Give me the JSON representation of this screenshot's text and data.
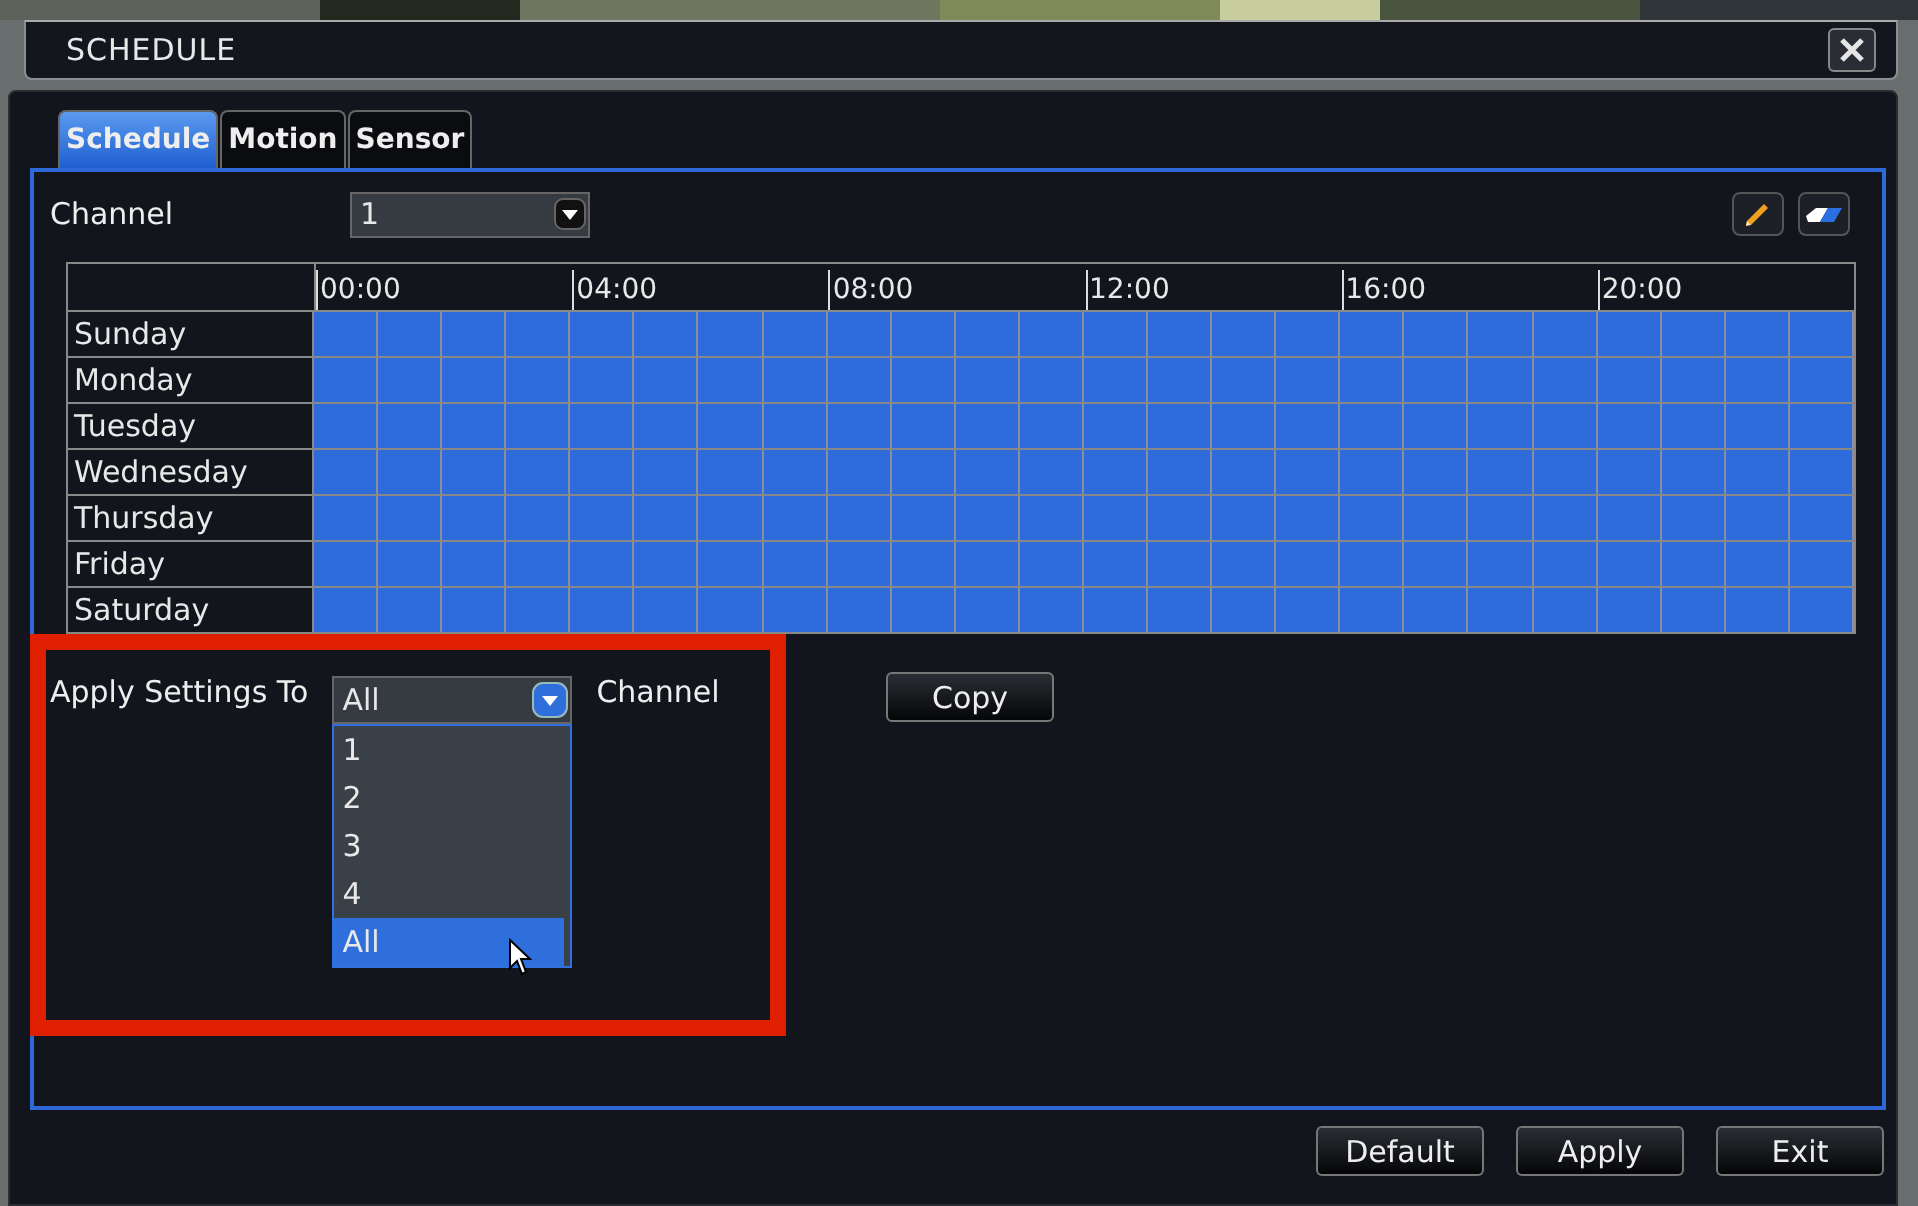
{
  "window": {
    "title": "SCHEDULE"
  },
  "tabs": [
    {
      "label": "Schedule",
      "selected": true
    },
    {
      "label": "Motion",
      "selected": false
    },
    {
      "label": "Sensor",
      "selected": false
    }
  ],
  "channel": {
    "label": "Channel",
    "value": "1"
  },
  "schedule": {
    "hour_labels": [
      "00:00",
      "04:00",
      "08:00",
      "12:00",
      "16:00",
      "20:00"
    ],
    "rows": [
      {
        "day": "Sunday",
        "hours": [
          true,
          true,
          true,
          true,
          true,
          true,
          true,
          true,
          true,
          true,
          true,
          true,
          true,
          true,
          true,
          true,
          true,
          true,
          true,
          true,
          true,
          true,
          true,
          true
        ]
      },
      {
        "day": "Monday",
        "hours": [
          true,
          true,
          true,
          true,
          true,
          true,
          true,
          true,
          true,
          true,
          true,
          true,
          true,
          true,
          true,
          true,
          true,
          true,
          true,
          true,
          true,
          true,
          true,
          true
        ]
      },
      {
        "day": "Tuesday",
        "hours": [
          true,
          true,
          true,
          true,
          true,
          true,
          true,
          true,
          true,
          true,
          true,
          true,
          true,
          true,
          true,
          true,
          true,
          true,
          true,
          true,
          true,
          true,
          true,
          true
        ]
      },
      {
        "day": "Wednesday",
        "hours": [
          true,
          true,
          true,
          true,
          true,
          true,
          true,
          true,
          true,
          true,
          true,
          true,
          true,
          true,
          true,
          true,
          true,
          true,
          true,
          true,
          true,
          true,
          true,
          true
        ]
      },
      {
        "day": "Thursday",
        "hours": [
          true,
          true,
          true,
          true,
          true,
          true,
          true,
          true,
          true,
          true,
          true,
          true,
          true,
          true,
          true,
          true,
          true,
          true,
          true,
          true,
          true,
          true,
          true,
          true
        ]
      },
      {
        "day": "Friday",
        "hours": [
          true,
          true,
          true,
          true,
          true,
          true,
          true,
          true,
          true,
          true,
          true,
          true,
          true,
          true,
          true,
          true,
          true,
          true,
          true,
          true,
          true,
          true,
          true,
          true
        ]
      },
      {
        "day": "Saturday",
        "hours": [
          true,
          true,
          true,
          true,
          true,
          true,
          true,
          true,
          true,
          true,
          true,
          true,
          true,
          true,
          true,
          true,
          true,
          true,
          true,
          true,
          true,
          true,
          true,
          true
        ]
      }
    ]
  },
  "apply": {
    "label": "Apply Settings To",
    "value": "All",
    "suffix": "Channel",
    "expanded": true,
    "options": [
      {
        "label": "1",
        "selected": false
      },
      {
        "label": "2",
        "selected": false
      },
      {
        "label": "3",
        "selected": false
      },
      {
        "label": "4",
        "selected": false
      },
      {
        "label": "All",
        "selected": true
      }
    ]
  },
  "copy_button": "Copy",
  "buttons": [
    "Default",
    "Apply",
    "Exit"
  ]
}
